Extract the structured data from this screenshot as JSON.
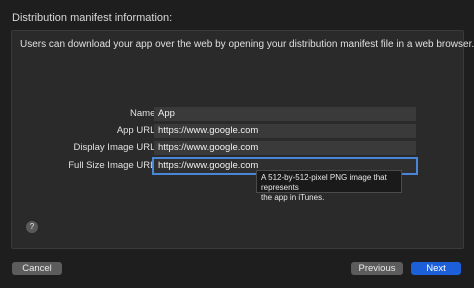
{
  "header": {
    "title": "Distribution manifest information:"
  },
  "panel": {
    "description": "Users can download your app over the web by opening your distribution manifest file in a web browser.",
    "fields": [
      {
        "label": "Name:",
        "value": "App"
      },
      {
        "label": "App URL:",
        "value": "https://www.google.com"
      },
      {
        "label": "Display Image URL:",
        "value": "https://www.google.com"
      },
      {
        "label": "Full Size Image URL:",
        "value": "https://www.google.com"
      }
    ],
    "tooltip": {
      "line1": "A 512-by-512-pixel PNG image that represents",
      "line2": "the app in iTunes."
    },
    "help_icon": "?"
  },
  "footer": {
    "cancel_label": "Cancel",
    "previous_label": "Previous",
    "next_label": "Next"
  }
}
